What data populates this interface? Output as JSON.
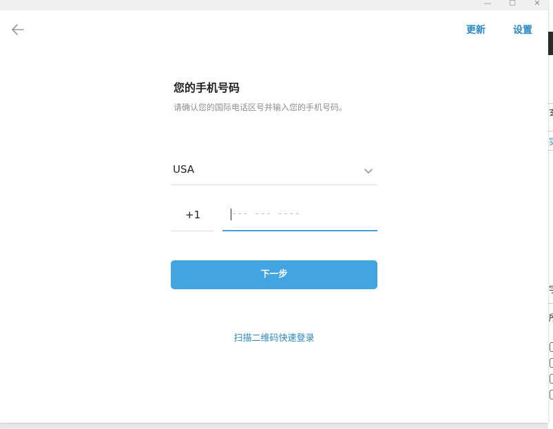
{
  "window": {
    "minimize_label": "—",
    "maximize_label": "☐",
    "close_label": "✕"
  },
  "header": {
    "back_icon": "arrow-left-icon",
    "update_label": "更新",
    "settings_label": "设置"
  },
  "login": {
    "title": "您的手机号码",
    "subtitle": "请确认您的国际电话区号并输入您的手机号码。",
    "country": {
      "selected": "USA",
      "icon": "chevron-down-icon"
    },
    "country_code": "+1",
    "phone": {
      "value": "",
      "placeholder": "--- --- ----"
    },
    "next_label": "下一步",
    "qr_label": "扫描二维码快速登录"
  },
  "colors": {
    "accent": "#42a5e2",
    "link": "#2a8ac9",
    "active_underline": "#3f9fdd"
  },
  "background_app": {
    "glyphs": [
      "玄",
      "实",
      "宇",
      "所"
    ]
  }
}
